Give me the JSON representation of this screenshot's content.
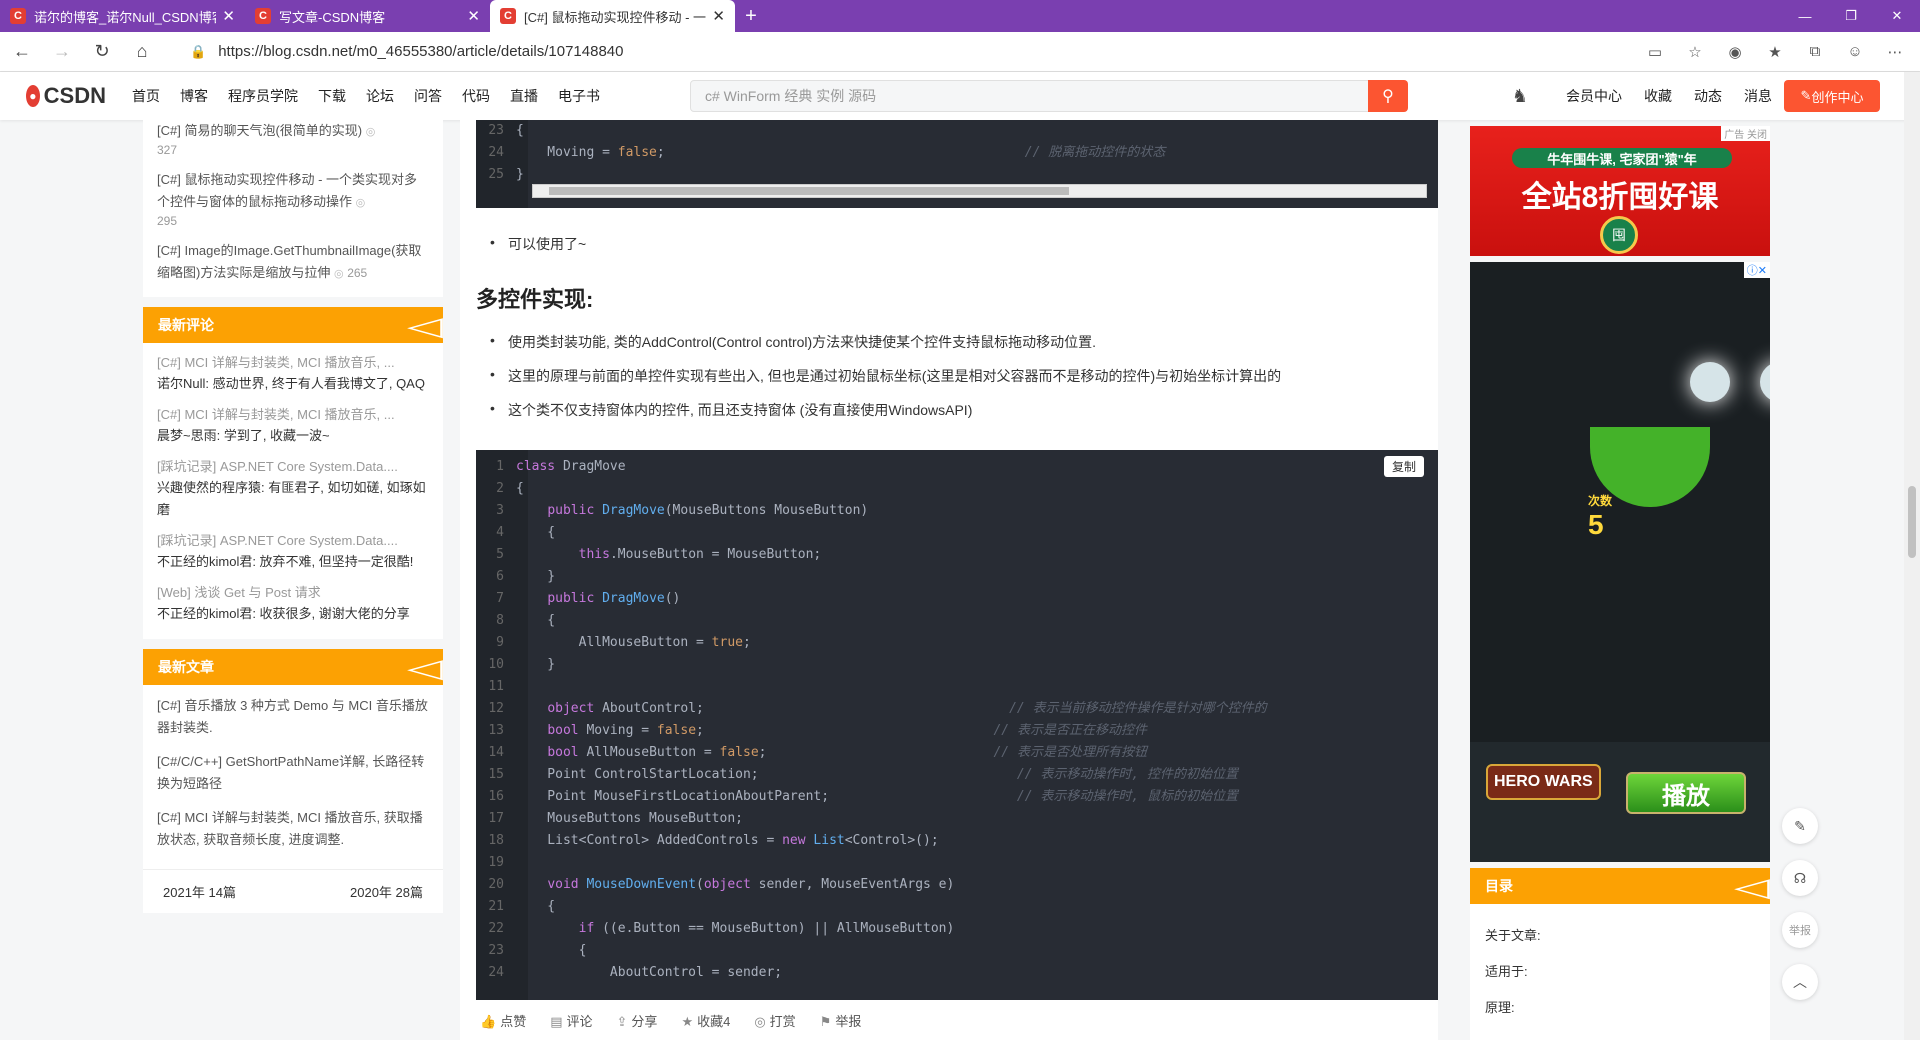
{
  "browser": {
    "tabs": [
      {
        "title": "诺尔的博客_诺尔Null_CSDN博客",
        "active": false
      },
      {
        "title": "写文章-CSDN博客",
        "active": false
      },
      {
        "title": "[C#] 鼠标拖动实现控件移动 - 一个...",
        "active": true
      }
    ],
    "url": "https://blog.csdn.net/m0_46555380/article/details/107148840"
  },
  "csdn": {
    "logo": "CSDN",
    "nav": [
      "首页",
      "博客",
      "程序员学院",
      "下载",
      "论坛",
      "问答",
      "代码",
      "直播",
      "电子书"
    ],
    "search_placeholder": "c# WinForm 经典 实例 源码",
    "user_nav": [
      "会员中心",
      "收藏",
      "动态",
      "消息"
    ],
    "create_label": "创作中心"
  },
  "sidebar": {
    "hot": [
      {
        "title": "[C#] 简易的聊天气泡(很简单的实现)",
        "views": "327"
      },
      {
        "title": "[C#] 鼠标拖动实现控件移动 - 一个类实现对多个控件与窗体的鼠标拖动移动操作",
        "views": "295"
      },
      {
        "title": "[C#] Image的Image.GetThumbnailImage(获取缩略图)方法实际是缩放与拉伸",
        "views": "265"
      }
    ],
    "comments_title": "最新评论",
    "comments": [
      {
        "article": "[C#] MCI 详解与封装类, MCI 播放音乐, ...",
        "text": "诺尔Null: 感动世界, 终于有人看我博文了, QAQ"
      },
      {
        "article": "[C#] MCI 详解与封装类, MCI 播放音乐, ...",
        "text": "晨梦~思雨: 学到了, 收藏一波~"
      },
      {
        "article": "[踩坑记录] ASP.NET Core System.Data....",
        "text": "兴趣使然的程序猿: 有匪君子, 如切如磋, 如琢如磨"
      },
      {
        "article": "[踩坑记录] ASP.NET Core System.Data....",
        "text": "不正经的kimol君: 放弃不难, 但坚持一定很酷!"
      },
      {
        "article": "[Web] 浅谈 Get 与 Post 请求",
        "text": "不正经的kimol君: 收获很多, 谢谢大佬的分享"
      }
    ],
    "new_title": "最新文章",
    "new_articles": [
      "[C#] 音乐播放 3 种方式 Demo 与 MCI 音乐播放器封装类.",
      "[C#/C/C++] GetShortPathName详解, 长路径转换为短路径",
      "[C#] MCI 详解与封装类, MCI 播放音乐, 获取播放状态, 获取音频长度, 进度调整."
    ],
    "archive": [
      "2021年 14篇",
      "2020年 28篇"
    ]
  },
  "article": {
    "top_code": [
      {
        "n": "23",
        "code": "{"
      },
      {
        "n": "24",
        "code": "    Moving = false;",
        "comment": "// 脱离拖动控件的状态"
      },
      {
        "n": "25",
        "code": "}"
      }
    ],
    "usable": "可以使用了~",
    "heading": "多控件实现:",
    "bullets": [
      "使用类封装功能, 类的AddControl(Control control)方法来快捷使某个控件支持鼠标拖动移动位置.",
      "这里的原理与前面的单控件实现有些出入, 但也是通过初始鼠标坐标(这里是相对父容器而不是移动的控件)与初始坐标计算出的",
      "这个类不仅支持窗体内的控件, 而且还支持窗体 (没有直接使用WindowsAPI)"
    ],
    "copy_label": "复制",
    "code_lines": [
      {
        "n": "1",
        "html": "<span class='kw'>class</span> DragMove"
      },
      {
        "n": "2",
        "html": "{"
      },
      {
        "n": "3",
        "html": "    <span class='kw'>public</span> <span class='fn'>DragMove</span>(MouseButtons MouseButton)"
      },
      {
        "n": "4",
        "html": "    {"
      },
      {
        "n": "5",
        "html": "        <span class='kw'>this</span>.MouseButton = MouseButton;"
      },
      {
        "n": "6",
        "html": "    }"
      },
      {
        "n": "7",
        "html": "    <span class='kw'>public</span> <span class='fn'>DragMove</span>()"
      },
      {
        "n": "8",
        "html": "    {"
      },
      {
        "n": "9",
        "html": "        AllMouseButton = <span class='bo'>true</span>;"
      },
      {
        "n": "10",
        "html": "    }"
      },
      {
        "n": "11",
        "html": ""
      },
      {
        "n": "12",
        "html": "    <span class='kw'>object</span> AboutControl;                                       <span class='cm'>// 表示当前移动控件操作是针对哪个控件的</span>"
      },
      {
        "n": "13",
        "html": "    <span class='kw'>bool</span> Moving = <span class='bo'>false</span>;                                     <span class='cm'>// 表示是否正在移动控件</span>"
      },
      {
        "n": "14",
        "html": "    <span class='kw'>bool</span> AllMouseButton = <span class='bo'>false</span>;                             <span class='cm'>// 表示是否处理所有按钮</span>"
      },
      {
        "n": "15",
        "html": "    Point ControlStartLocation;                                 <span class='cm'>// 表示移动操作时, 控件的初始位置</span>"
      },
      {
        "n": "16",
        "html": "    Point MouseFirstLocationAboutParent;                        <span class='cm'>// 表示移动操作时, 鼠标的初始位置</span>"
      },
      {
        "n": "17",
        "html": "    MouseButtons MouseButton;"
      },
      {
        "n": "18",
        "html": "    List&lt;Control&gt; AddedControls = <span class='kw'>new</span> <span class='fn'>List</span>&lt;Control&gt;();"
      },
      {
        "n": "19",
        "html": ""
      },
      {
        "n": "20",
        "html": "    <span class='kw'>void</span> <span class='fn'>MouseDownEvent</span>(<span class='kw'>object</span> sender, MouseEventArgs e)"
      },
      {
        "n": "21",
        "html": "    {"
      },
      {
        "n": "22",
        "html": "        <span class='kw'>if</span> ((e.Button == MouseButton) || AllMouseButton)"
      },
      {
        "n": "23",
        "html": "        {"
      },
      {
        "n": "24",
        "html": "            AboutControl = sender;"
      }
    ]
  },
  "footer": [
    "点赞",
    "评论",
    "分享",
    "收藏4",
    "打赏",
    "举报"
  ],
  "right": {
    "ad1_top": "牛年围牛课, 宅家团\"猿\"年",
    "ad1_big": "全站8折囤好课",
    "ad1_tag": "广告 关闭",
    "ad2_count_label": "次数",
    "ad2_count": "5",
    "ad2_brand": "HERO WARS",
    "ad2_play": "播放",
    "toc_title": "目录",
    "toc": [
      "关于文章:",
      "适用于:",
      "原理:"
    ]
  },
  "float_tools": [
    "编辑",
    "客服",
    "举报",
    "返回顶部"
  ]
}
